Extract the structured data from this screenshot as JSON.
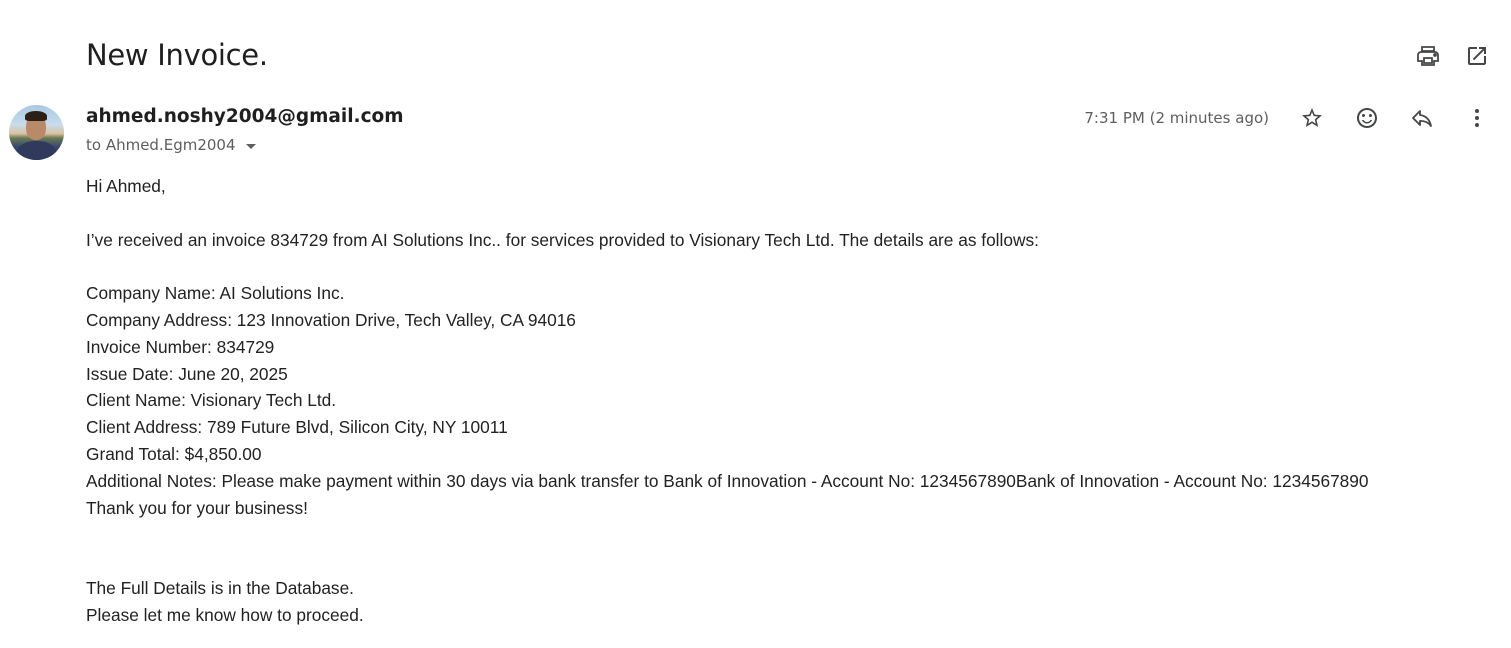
{
  "email": {
    "subject": "New Invoice.",
    "sender": "ahmed.noshy2004@gmail.com",
    "recipient": "to Ahmed.Egm2004",
    "timestamp": "7:31 PM (2 minutes ago)"
  },
  "icons": {
    "print": "print-icon",
    "open_new": "open-in-new-window-icon",
    "star": "star-icon",
    "emoji": "emoji-reaction-icon",
    "reply": "reply-icon",
    "more": "more-vert-icon"
  },
  "body": {
    "greeting": "Hi Ahmed,",
    "intro": "I’ve received an invoice 834729 from AI Solutions Inc.. for services provided to Visionary Tech Ltd. The details are as follows:",
    "details": [
      "Company Name: AI Solutions Inc.",
      "Company Address: 123 Innovation Drive, Tech Valley, CA 94016",
      "Invoice Number: 834729",
      "Issue Date: June 20, 2025",
      "Client Name: Visionary Tech Ltd.",
      "Client Address: 789 Future Blvd, Silicon City, NY 10011",
      "Grand Total: $4,850.00",
      "Additional Notes: Please make payment within 30 days via bank transfer to Bank of Innovation - Account No: 1234567890Bank of Innovation - Account No: 1234567890",
      "Thank you for your business!"
    ],
    "closing": [
      "The Full Details is in the Database.",
      "Please let me know how to proceed."
    ]
  }
}
